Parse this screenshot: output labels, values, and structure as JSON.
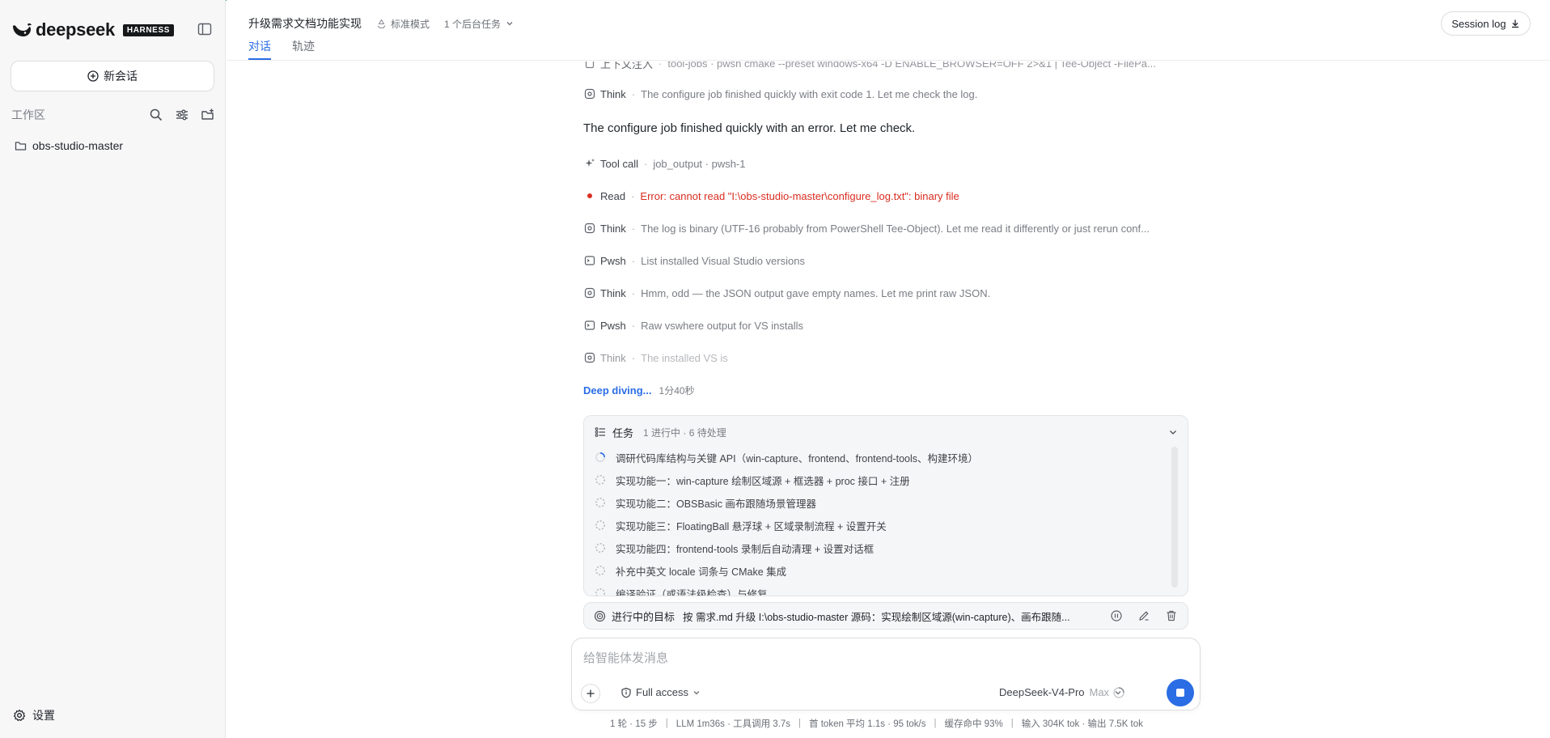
{
  "brand": {
    "name": "deepseek",
    "badge": "HARNESS"
  },
  "sidebar": {
    "new_chat_label": "新会话",
    "workspace_label": "工作区",
    "folders": [
      {
        "label": "obs-studio-master"
      }
    ],
    "settings_label": "设置"
  },
  "header": {
    "title": "升级需求文档功能实现",
    "mode": "标准模式",
    "background_tasks": "1 个后台任务",
    "tabs": [
      {
        "label": "对话",
        "active": true
      },
      {
        "label": "轨迹",
        "active": false
      }
    ],
    "session_log_label": "Session log"
  },
  "conversation": {
    "truncated_step": {
      "kind": "上下文注入",
      "detail": "tool-jobs · pwsh cmake --preset windows-x64 -D ENABLE_BROWSER=OFF 2>&1 | Tee-Object -FilePa..."
    },
    "steps": [
      {
        "kind": "Think",
        "icon": "think-icon",
        "detail": "The configure job finished quickly with exit code 1. Let me check the log."
      },
      {
        "kind": "Tool call",
        "icon": "sparkle-icon",
        "detail": "job_output · pwsh-1"
      },
      {
        "kind": "Read",
        "icon": "error-dot-icon",
        "detail": "Error: cannot read \"I:\\obs-studio-master\\configure_log.txt\": binary file",
        "error": true
      },
      {
        "kind": "Think",
        "icon": "think-icon",
        "detail": "The log is binary (UTF-16 probably from PowerShell Tee-Object). Let me read it differently or just rerun conf..."
      },
      {
        "kind": "Pwsh",
        "icon": "terminal-icon",
        "detail": "List installed Visual Studio versions"
      },
      {
        "kind": "Think",
        "icon": "think-icon",
        "detail": "Hmm, odd — the JSON output gave empty names. Let me print raw JSON."
      },
      {
        "kind": "Pwsh",
        "icon": "terminal-icon",
        "detail": "Raw vswhere output for VS installs"
      },
      {
        "kind": "Think",
        "icon": "think-icon",
        "detail": "The installed VS is"
      }
    ],
    "reply": "The configure job finished quickly with an error. Let me check.",
    "deep_label": "Deep diving...",
    "deep_time": "1分40秒"
  },
  "tasks": {
    "title": "任务",
    "summary": "1 进行中 · 6 待处理",
    "items": [
      {
        "label": "调研代码库结构与关键 API（win-capture、frontend、frontend-tools、构建环境）",
        "status": "in_progress"
      },
      {
        "label": "实现功能一：win-capture 绘制区域源 + 框选器 + proc 接口 + 注册",
        "status": "pending"
      },
      {
        "label": "实现功能二：OBSBasic 画布跟随场景管理器",
        "status": "pending"
      },
      {
        "label": "实现功能三：FloatingBall 悬浮球 + 区域录制流程 + 设置开关",
        "status": "pending"
      },
      {
        "label": "实现功能四：frontend-tools 录制后自动清理 + 设置对话框",
        "status": "pending"
      },
      {
        "label": "补充中英文 locale 词条与 CMake 集成",
        "status": "pending"
      },
      {
        "label": "编译验证（或语法级检查）与修复",
        "status": "pending"
      }
    ]
  },
  "goal": {
    "label": "进行中的目标",
    "text": "按 需求.md 升级 I:\\obs-studio-master 源码：实现绘制区域源(win-capture)、画布跟随..."
  },
  "composer": {
    "placeholder": "给智能体发消息",
    "value": "",
    "access_label": "Full access",
    "model": "DeepSeek-V4-Pro",
    "model_tier": "Max"
  },
  "status_bar": [
    "1 轮 · 15 步",
    "LLM 1m36s · 工具调用 3.7s",
    "首 token 平均 1.1s · 95 tok/s",
    "缓存命中 93%",
    "输入 304K tok · 输出 7.5K tok"
  ],
  "colors": {
    "accent": "#2b6de5",
    "error": "#d92d20",
    "top_line": "#2f8f5b"
  }
}
